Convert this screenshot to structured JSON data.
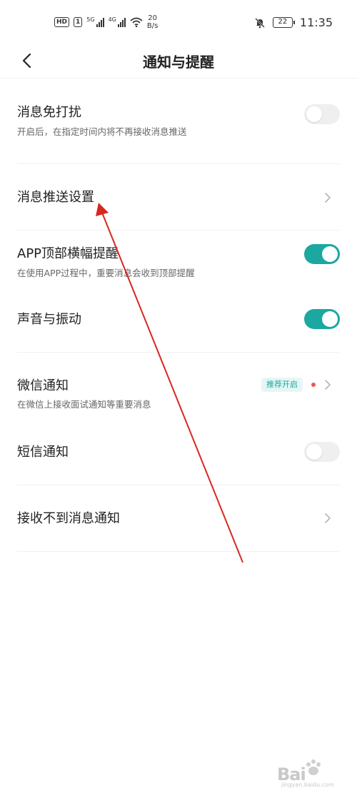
{
  "status_bar": {
    "hd": "HD",
    "hd_slot": "1",
    "sim1_type": "5G",
    "sim2_type": "4G",
    "net_speed_value": "20",
    "net_speed_unit": "B/s",
    "battery": "22",
    "time": "11:35"
  },
  "header": {
    "title": "通知与提醒"
  },
  "items": [
    {
      "title": "消息免打扰",
      "desc": "开启后，在指定时间内将不再接收消息推送",
      "toggle": "off"
    },
    {
      "title": "消息推送设置"
    },
    {
      "title": "APP顶部横幅提醒",
      "desc": "在使用APP过程中，重要消息会收到顶部提醒",
      "toggle": "on"
    },
    {
      "title": "声音与振动",
      "toggle": "on"
    },
    {
      "title": "微信通知",
      "desc": "在微信上接收面试通知等重要消息",
      "tag": "推荐开启"
    },
    {
      "title": "短信通知",
      "toggle": "off"
    },
    {
      "title": "接收不到消息通知"
    }
  ],
  "colors": {
    "accent": "#1aa8a0",
    "tag_bg": "#e6f6f5",
    "red_dot": "#f25555",
    "toggle_off": "#efefef",
    "annotation": "#d8281e"
  },
  "watermark": {
    "brand": "Bai",
    "sub": "jingyan.baidu.com"
  }
}
